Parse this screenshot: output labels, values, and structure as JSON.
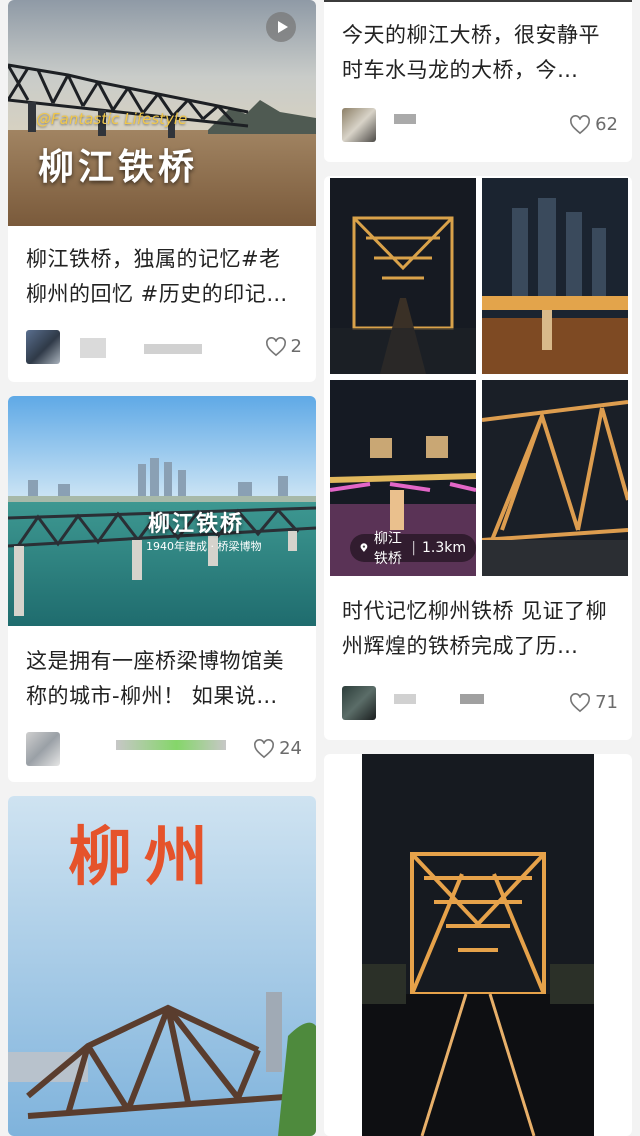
{
  "feed": {
    "cards": [
      {
        "id": "card1",
        "watermark": "@Fantastic Lifestyle",
        "overlay": "柳江铁桥",
        "title": "柳江铁桥，独属的记忆#老柳州的回忆 #历史的印记…",
        "likes": "2"
      },
      {
        "id": "card2",
        "title": "今天的柳江大桥，很安静平时车水马龙的大桥，今…",
        "likes": "62"
      },
      {
        "id": "card3",
        "overlay": "柳江铁桥",
        "overlay_sub": "1940年建成 · 桥梁博物",
        "title": "这是拥有一座桥梁博物馆美称的城市-柳州！ 如果说…",
        "likes": "24"
      },
      {
        "id": "card4",
        "location": "柳江铁桥",
        "distance": "1.3km",
        "title": "时代记忆柳州铁桥 见证了柳州辉煌的铁桥完成了历…",
        "likes": "71"
      },
      {
        "id": "card5",
        "overlay": "柳州"
      }
    ]
  },
  "colors": {
    "card_bg": "#ffffff",
    "page_bg": "#f3f3f3",
    "title_text": "#222222",
    "likes_text": "#6b6b6b",
    "overlay_red": "#e5532b"
  },
  "icons": [
    "play-icon",
    "heart-icon",
    "location-pin-icon"
  ]
}
